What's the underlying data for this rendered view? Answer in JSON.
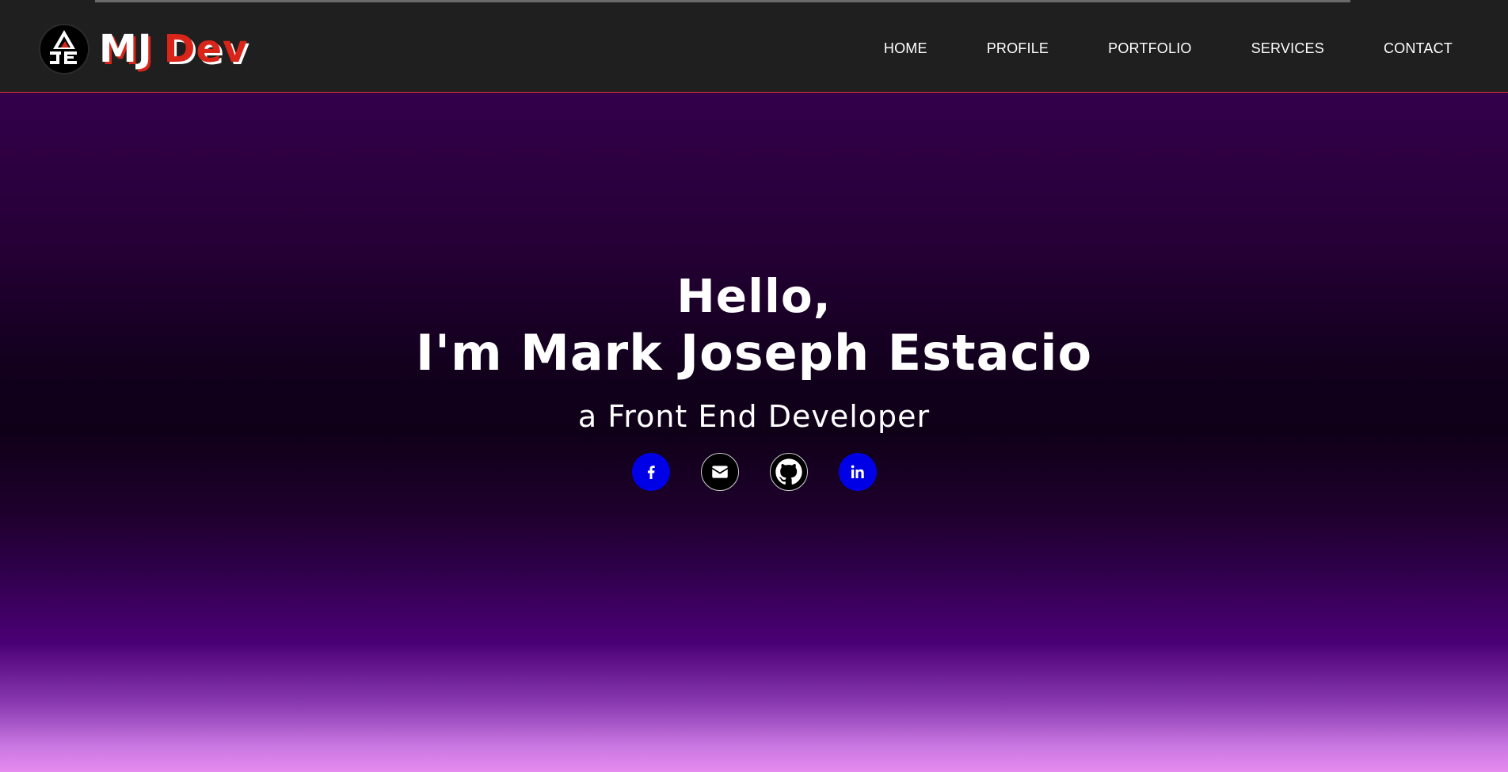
{
  "brand": {
    "logo_icon": "mj-logo-icon",
    "name_part1": "MJ",
    "name_part2": "Dev",
    "accent_color": "#d9241a"
  },
  "nav": {
    "items": [
      {
        "label": "HOME"
      },
      {
        "label": "PROFILE"
      },
      {
        "label": "PORTFOLIO"
      },
      {
        "label": "SERVICES"
      },
      {
        "label": "CONTACT"
      }
    ]
  },
  "hero": {
    "greeting": "Hello,",
    "name_line": "I'm Mark Joseph Estacio",
    "role_line": "a Front End Developer"
  },
  "socials": [
    {
      "icon": "facebook-icon",
      "color": "#0000e6"
    },
    {
      "icon": "email-icon",
      "color": "#000000"
    },
    {
      "icon": "github-icon",
      "color": "#000000"
    },
    {
      "icon": "linkedin-icon",
      "color": "#0000e6"
    }
  ],
  "colors": {
    "header_bg": "#1f1f1f",
    "header_border": "#d83a2a",
    "hero_top": "#33004b",
    "hero_mid": "#0f0018",
    "hero_bottom": "#e68bef"
  }
}
